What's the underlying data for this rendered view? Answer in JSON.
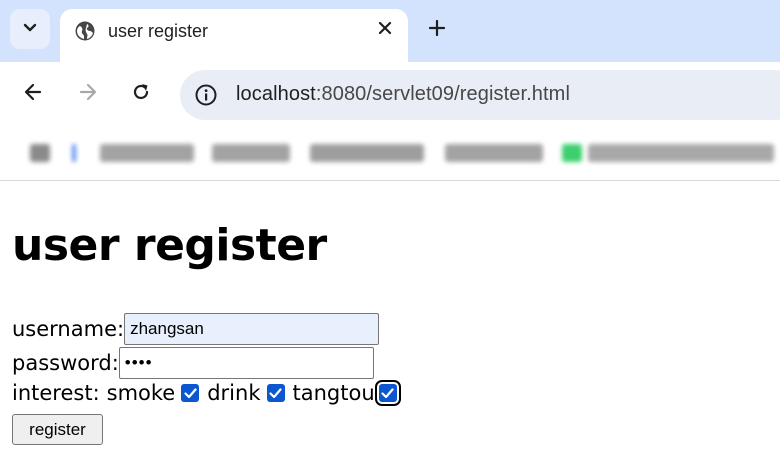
{
  "browser": {
    "tab_title": "user register",
    "url_host": "localhost",
    "url_path": ":8080/servlet09/register.html",
    "accent": "#0b57d0",
    "tabbar_bg": "#d3e3fd"
  },
  "page": {
    "title": "user register",
    "username_label": "username:",
    "username_value": "zhangsan",
    "password_label": "password:",
    "password_mask": "••••",
    "interest_label": "interest:",
    "interests": [
      {
        "label": "smoke",
        "checked": true
      },
      {
        "label": "drink",
        "checked": true
      },
      {
        "label": "tangtou",
        "checked": true
      }
    ],
    "register_label": "register"
  }
}
